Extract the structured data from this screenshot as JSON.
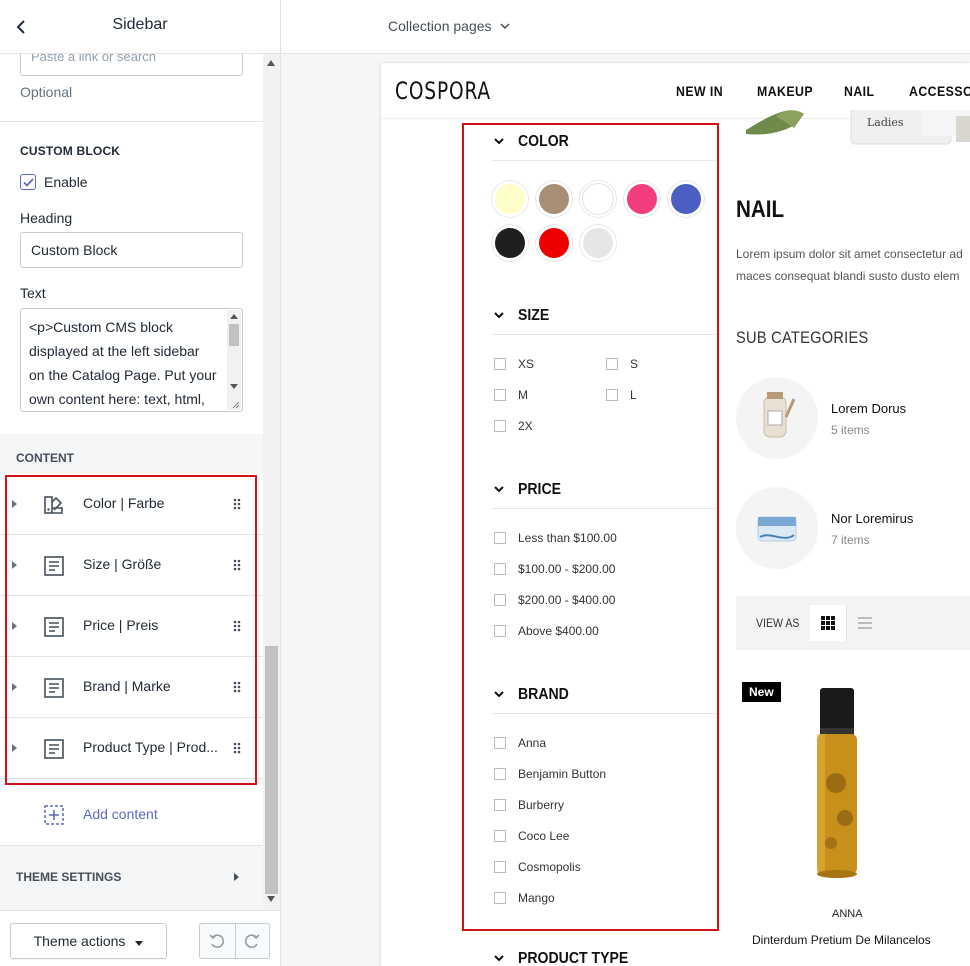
{
  "panel": {
    "title": "Sidebar",
    "link_placeholder": "Paste a link or search",
    "optional_label": "Optional",
    "custom_block": {
      "section_title": "CUSTOM BLOCK",
      "enable_label": "Enable",
      "enabled": true,
      "heading_label": "Heading",
      "heading_value": "Custom Block",
      "text_label": "Text",
      "text_value": "<p>Custom CMS block displayed at the left sidebar on the Catalog Page. Put your own content here: text, html,"
    },
    "content_label": "CONTENT",
    "blocks": [
      {
        "label": "Color | Farbe",
        "icon": "color-palette-icon"
      },
      {
        "label": "Size | Größe",
        "icon": "text-block-icon"
      },
      {
        "label": "Price | Preis",
        "icon": "text-block-icon"
      },
      {
        "label": "Brand | Marke",
        "icon": "text-block-icon"
      },
      {
        "label": "Product Type | Prod...",
        "icon": "text-block-icon"
      }
    ],
    "add_content_label": "Add content",
    "theme_settings_label": "THEME SETTINGS",
    "theme_actions_label": "Theme actions"
  },
  "topbar": {
    "page_select": "Collection pages"
  },
  "store": {
    "logo": "COSPORA",
    "nav": [
      "NEW IN",
      "MAKEUP",
      "NAIL",
      "ACCESSOR"
    ],
    "hero_label": "Ladies",
    "filters": {
      "color": {
        "title": "COLOR",
        "swatches": [
          "#fffec8",
          "#a88d77",
          "#ffffff",
          "#f23e7f",
          "#4a5fc1",
          "#1f1f1f",
          "#ee0000",
          "#e6e6e6"
        ]
      },
      "size": {
        "title": "SIZE",
        "options": [
          "XS",
          "S",
          "M",
          "L",
          "2X"
        ]
      },
      "price": {
        "title": "PRICE",
        "options": [
          "Less than $100.00",
          "$100.00 - $200.00",
          "$200.00 - $400.00",
          "Above $400.00"
        ]
      },
      "brand": {
        "title": "BRAND",
        "options": [
          "Anna",
          "Benjamin Button",
          "Burberry",
          "Coco Lee",
          "Cosmopolis",
          "Mango"
        ]
      },
      "product_type": {
        "title": "PRODUCT TYPE"
      }
    },
    "category": {
      "title": "NAIL",
      "description_line1": "Lorem ipsum dolor sit amet consectetur ad",
      "description_line2": "maces consequat blandi susto dusto elem"
    },
    "sub_categories": {
      "title": "SUB CATEGORIES",
      "items": [
        {
          "name": "Lorem Dorus",
          "count": "5 items"
        },
        {
          "name": "Nor Loremirus",
          "count": "7 items"
        }
      ]
    },
    "view_as_label": "VIEW AS",
    "product": {
      "badge": "New",
      "brand": "ANNA",
      "name": "Dinterdum Pretium De Milancelos"
    }
  },
  "colors": {
    "accent": "#5c6ac4",
    "highlight_box": "#d0111b"
  }
}
